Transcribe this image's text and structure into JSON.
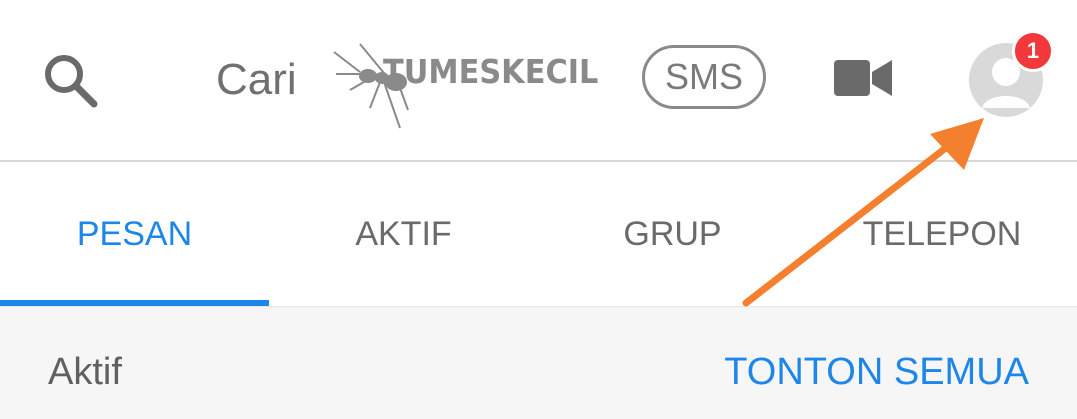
{
  "header": {
    "search_placeholder": "Cari",
    "watermark_text": "TUMESKECIL",
    "sms_label": "SMS",
    "notification_count": "1",
    "icons": {
      "search": "search-icon",
      "video": "video-camera-icon",
      "profile": "profile-avatar-icon"
    }
  },
  "tabs": [
    {
      "label": "PESAN",
      "active": true
    },
    {
      "label": "AKTIF",
      "active": false
    },
    {
      "label": "GRUP",
      "active": false
    },
    {
      "label": "TELEPON",
      "active": false
    }
  ],
  "section": {
    "title": "Aktif",
    "link": "TONTON SEMUA"
  },
  "colors": {
    "accent": "#1d86e8",
    "badge": "#f2383a",
    "annotation_arrow": "#f47f2f"
  }
}
